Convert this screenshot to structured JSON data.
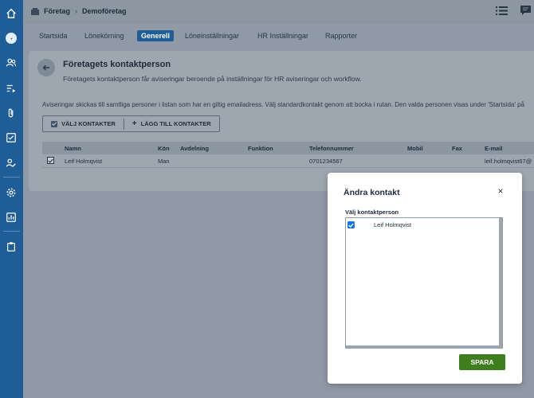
{
  "breadcrumb": {
    "root": "Företag",
    "current": "Demoföretag"
  },
  "tabs": [
    "Startsida",
    "Lönekörning",
    "Generell",
    "Löneinställningar",
    "HR Inställningar",
    "Rapporter"
  ],
  "active_tab": "Generell",
  "panel": {
    "title": "Företagets kontaktperson",
    "subtitle": "Företagets kontaktperson får aviseringar beroende på inställningar för HR aviseringar och workflow.",
    "description": "Aviseringar skickas till samtliga personer i listan som har en giltig emailadress. Välj standardkontakt genom att bocka i rutan. Den valda personen visas under 'Startsida' på",
    "btn_select": "VÄLJ KONTAKTER",
    "btn_add": "LÄGG TILL KONTAKTER"
  },
  "table": {
    "columns": [
      "Namn",
      "Kön",
      "Avdelning",
      "Funktion",
      "Telefonnummer",
      "Mobil",
      "Fax",
      "E-mail"
    ],
    "rows": [
      {
        "checked": true,
        "namn": "Leif Holmqvist",
        "kon": "Man",
        "avdelning": "",
        "funktion": "",
        "telefon": "0701234567",
        "mobil": "",
        "fax": "",
        "email": "leif.holmqvist67@"
      }
    ]
  },
  "modal": {
    "title": "Ändra kontakt",
    "close": "×",
    "label": "Välj kontaktperson",
    "items": [
      {
        "name": "Leif Holmqvist",
        "checked": true
      }
    ],
    "save": "SPARA"
  },
  "colors": {
    "rail": "#1f5d99",
    "active_tab": "#1f5d99",
    "save": "#3f7e1c",
    "checkbox": "#1a73e8"
  }
}
